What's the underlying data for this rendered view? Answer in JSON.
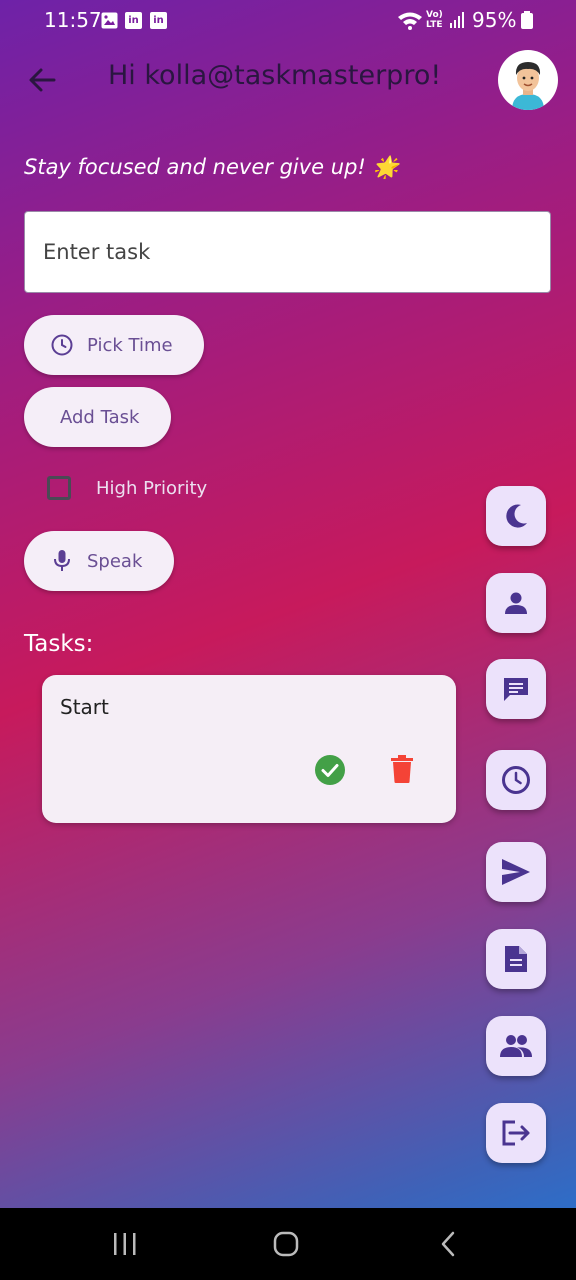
{
  "status_bar": {
    "time": "11:57",
    "notification_icons": [
      "gallery-icon",
      "linkedin-icon",
      "linkedin-icon"
    ],
    "network": "LTE",
    "battery_percent": "95%"
  },
  "header": {
    "back_icon": "arrow-left-icon",
    "greeting": "Hi kolla@taskmasterpro!",
    "avatar": "user-avatar"
  },
  "quote": "Stay focused and never give up! 🌟",
  "task_input": {
    "placeholder": "Enter task",
    "value": ""
  },
  "buttons": {
    "pick_time": "Pick Time",
    "add_task": "Add Task",
    "speak": "Speak"
  },
  "high_priority": {
    "label": "High Priority",
    "checked": false
  },
  "tasks_heading": "Tasks:",
  "tasks": [
    {
      "title": "Start",
      "done_icon": "check-circle-icon",
      "delete_icon": "trash-icon"
    }
  ],
  "side_actions": [
    "moon-icon",
    "person-icon",
    "chat-icon",
    "clock-icon",
    "send-icon",
    "document-icon",
    "group-icon",
    "logout-icon"
  ],
  "colors": {
    "accent": "#5b3e94",
    "fab_bg": "#ece2fb",
    "done": "#43a047",
    "delete": "#f44336"
  },
  "system_nav": [
    "recents-icon",
    "home-icon",
    "back-icon"
  ]
}
